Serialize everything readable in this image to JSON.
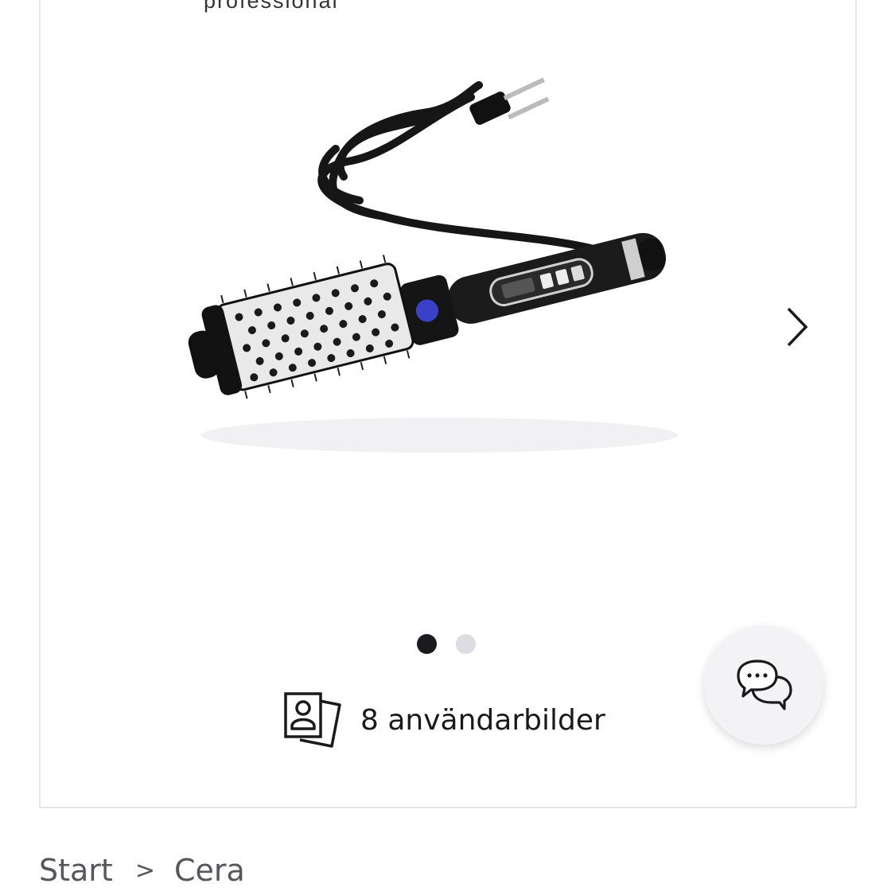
{
  "brand": {
    "subtitle": "professional"
  },
  "gallery": {
    "image_alt": "Cera hair styling brush",
    "total_slides": 2,
    "active_slide": 1
  },
  "user_images": {
    "label": "8 användarbilder"
  },
  "breadcrumb": {
    "items": [
      "Start",
      "Cera"
    ],
    "separator": ">"
  },
  "colors": {
    "dot_active": "#1b1b1f",
    "dot_inactive": "#dcdde2",
    "card_border": "#e6e6e9",
    "breadcrumb_text": "#56575c"
  },
  "icons": {
    "next": "chevron-right-icon",
    "user_images": "user-photos-icon",
    "chat": "chat-bubbles-icon"
  }
}
